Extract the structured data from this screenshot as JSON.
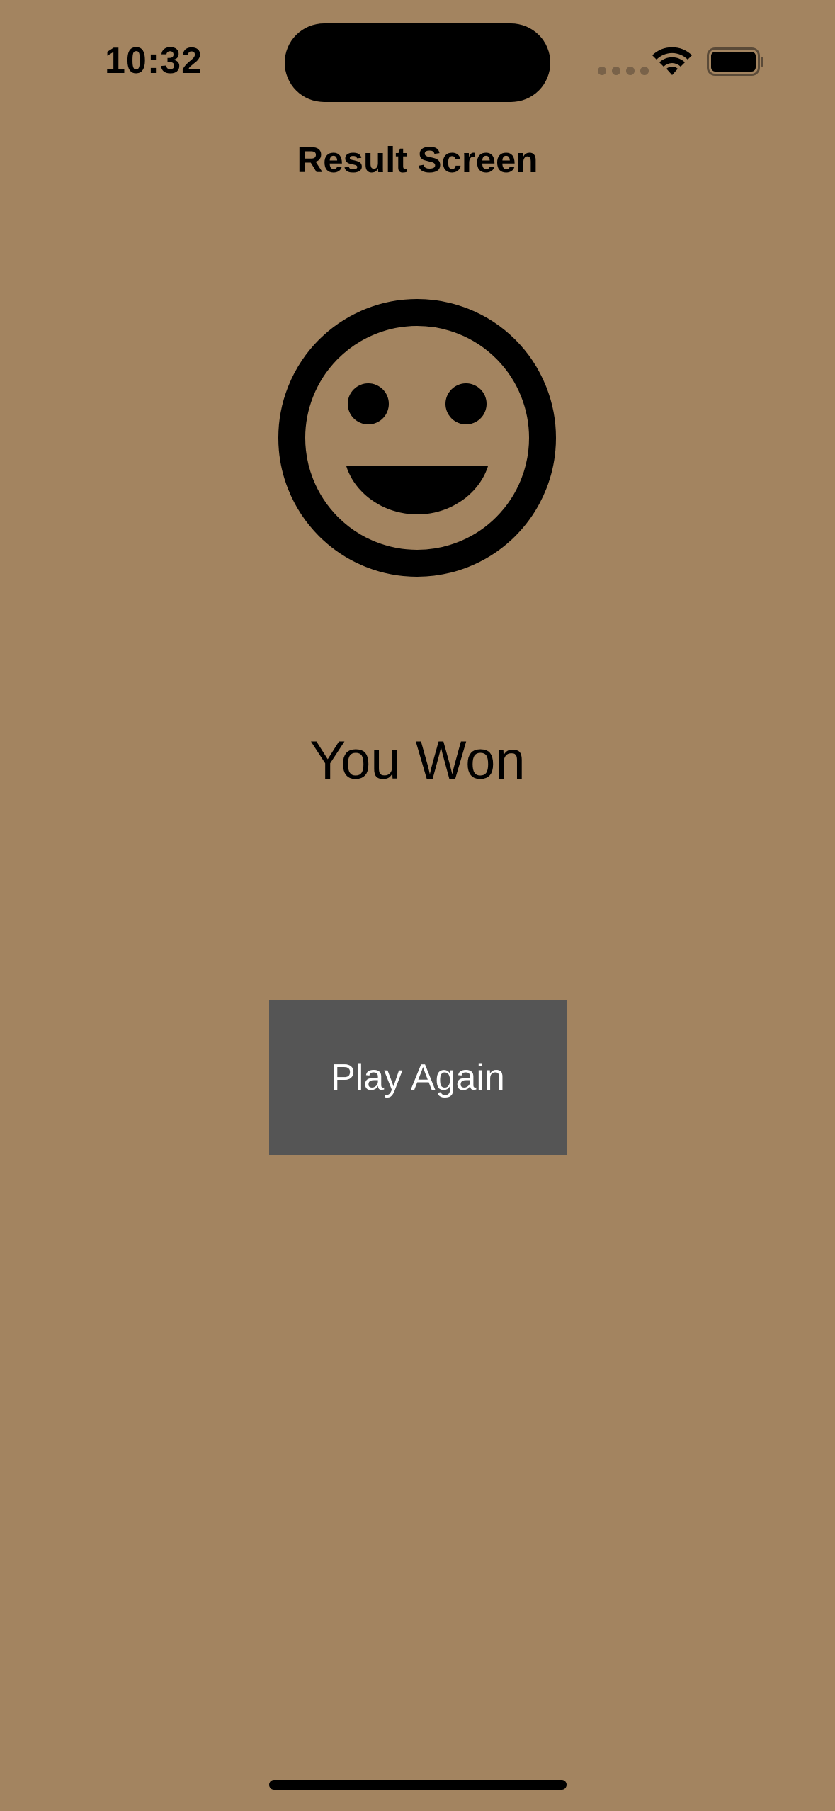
{
  "status_bar": {
    "time": "10:32",
    "icons": [
      "cellular-signal-icon",
      "wifi-icon",
      "battery-icon"
    ]
  },
  "header": {
    "title": "Result Screen"
  },
  "result": {
    "icon": "smiley-face-icon",
    "message": "You Won"
  },
  "actions": {
    "play_again_label": "Play Again"
  },
  "colors": {
    "background": "#a38460",
    "button_background": "#555555",
    "button_text": "#ffffff",
    "text": "#000000"
  }
}
